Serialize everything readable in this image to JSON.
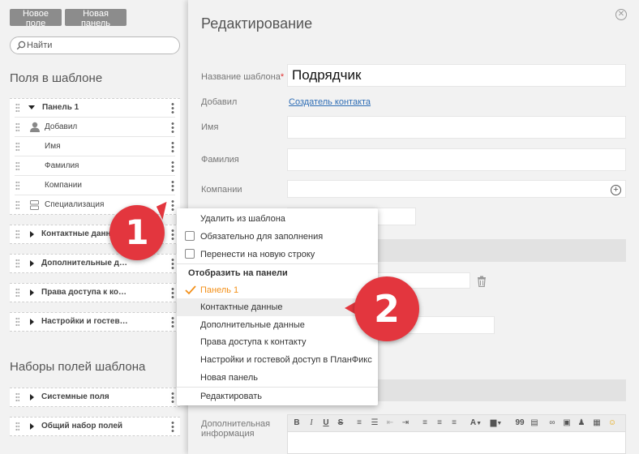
{
  "left": {
    "buttons": {
      "new_field": "Новое поле",
      "new_panel": "Новая панель"
    },
    "search": {
      "placeholder": "Найти"
    },
    "fields_title": "Поля в шаблоне",
    "panel1": {
      "title": "Панель 1",
      "items": [
        "Добавил",
        "Имя",
        "Фамилия",
        "Компании",
        "Специализация"
      ]
    },
    "panels": [
      "Контактные данн",
      "Дополнительные д…",
      "Права доступа к ко…",
      "Настройки и гостев…"
    ],
    "sets_title": "Наборы полей шаблона",
    "sets": [
      "Системные поля",
      "Общий набор полей"
    ]
  },
  "editor": {
    "title": "Редактирование",
    "template_name_label": "Название шаблона",
    "template_name_value": "Подрядчик",
    "author_label": "Добавил",
    "author_link": "Создатель контакта",
    "first_name_label": "Имя",
    "last_name_label": "Фамилия",
    "companies_label": "Компании",
    "extra_info_label_1": "Дополнительная",
    "extra_info_label_2": "информация"
  },
  "menu": {
    "remove": "Удалить из шаблона",
    "required": "Обязательно для заполнения",
    "new_line": "Перенести на новую строку",
    "show_on_panel": "Отобразить на панели",
    "panels": [
      "Панель 1",
      "Контактные данные",
      "Дополнительные данные",
      "Права доступа к контакту",
      "Настройки и гостевой доступ в ПланФикс",
      "Новая панель"
    ],
    "edit": "Редактировать",
    "active_color": "#f39019"
  },
  "badges": {
    "one": "1",
    "two": "2",
    "color": "#e3363e"
  },
  "toolbar": {
    "bold": "B",
    "italic": "I",
    "underline": "U",
    "strike": "S",
    "font_color": "A",
    "quote": "99"
  }
}
